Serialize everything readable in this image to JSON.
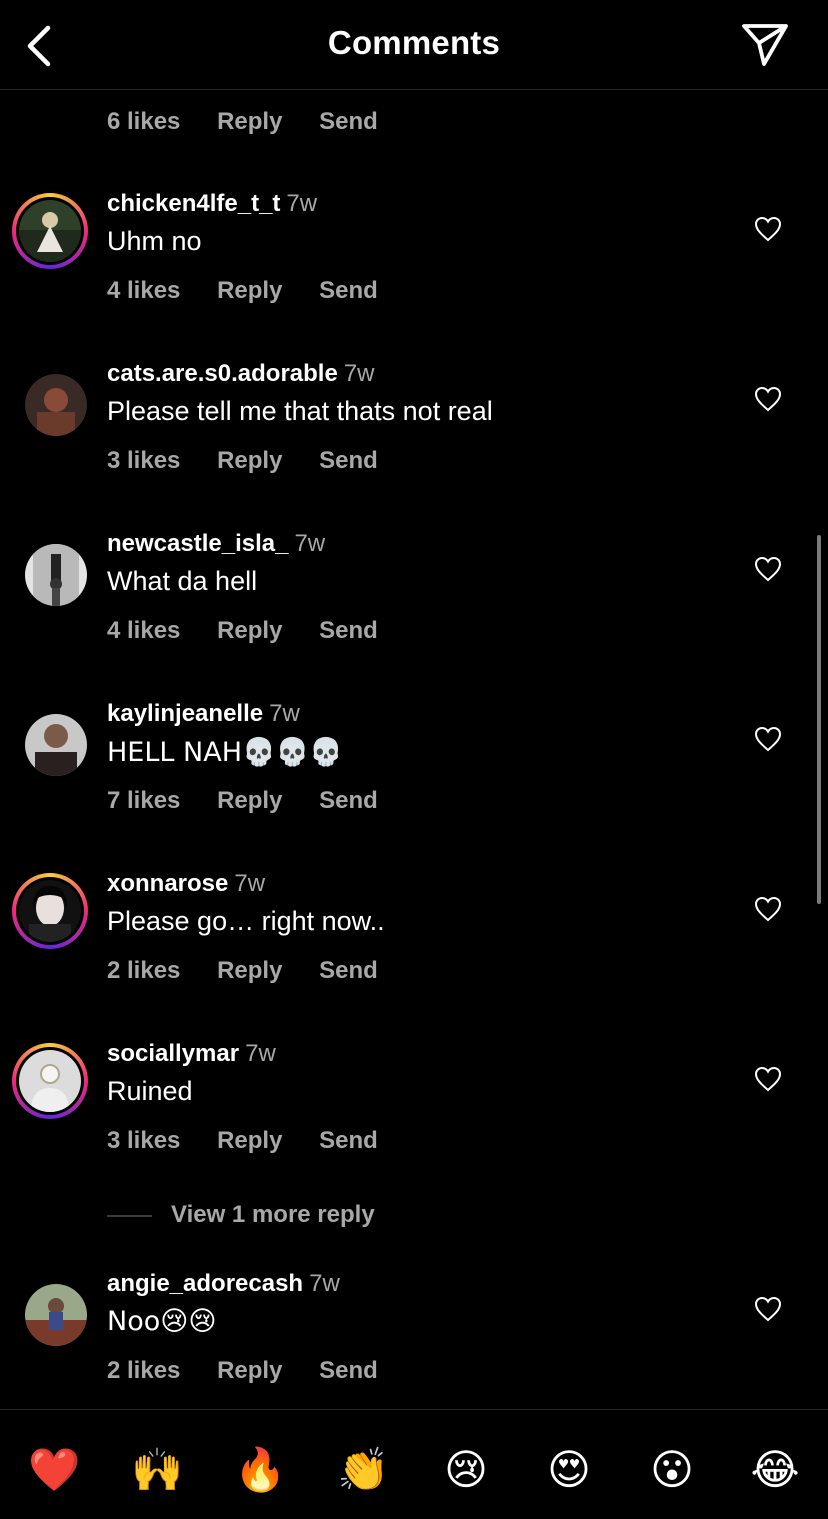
{
  "header": {
    "title": "Comments",
    "back_icon": "chevron-left-icon",
    "send_icon": "paper-plane-icon"
  },
  "partial_comment": {
    "likes": "6 likes",
    "reply": "Reply",
    "send": "Send"
  },
  "comments": [
    {
      "username": "chicken4lfe_t_t",
      "time": "7w",
      "text": "Uhm no",
      "likes": "4 likes",
      "reply": "Reply",
      "send": "Send",
      "story_ring": true,
      "avatar_color": "#3c4a2d"
    },
    {
      "username": "cats.are.s0.adorable",
      "time": "7w",
      "text": "Please tell me that thats not real",
      "likes": "3 likes",
      "reply": "Reply",
      "send": "Send",
      "story_ring": false,
      "avatar_color": "#5a3a30"
    },
    {
      "username": "newcastle_isla_",
      "time": "7w",
      "text": "What da hell",
      "likes": "4 likes",
      "reply": "Reply",
      "send": "Send",
      "story_ring": false,
      "avatar_color": "#9c9c9c"
    },
    {
      "username": "kaylinjeanelle",
      "time": "7w",
      "text": "HELL NAH💀💀💀",
      "likes": "7 likes",
      "reply": "Reply",
      "send": "Send",
      "story_ring": false,
      "avatar_color": "#6b5448"
    },
    {
      "username": "xonnarose",
      "time": "7w",
      "text": "Please go… right now..",
      "likes": "2 likes",
      "reply": "Reply",
      "send": "Send",
      "story_ring": true,
      "avatar_color": "#1a1a1a"
    },
    {
      "username": "sociallymar",
      "time": "7w",
      "text": "Ruined",
      "likes": "3 likes",
      "reply": "Reply",
      "send": "Send",
      "story_ring": true,
      "avatar_color": "#d8d8d8"
    },
    {
      "username": "angie_adorecash",
      "time": "7w",
      "text": "Noo😢😢",
      "likes": "2 likes",
      "reply": "Reply",
      "send": "Send",
      "story_ring": false,
      "avatar_color": "#4a5a3a"
    }
  ],
  "view_more_reply": "View 1 more reply",
  "reactions": [
    "❤️",
    "🙌",
    "🔥",
    "👏",
    "😢",
    "😍",
    "😮",
    "😂"
  ],
  "colors": {
    "background": "#000000",
    "secondary_text": "#a8a8a8",
    "divider": "#262626"
  }
}
